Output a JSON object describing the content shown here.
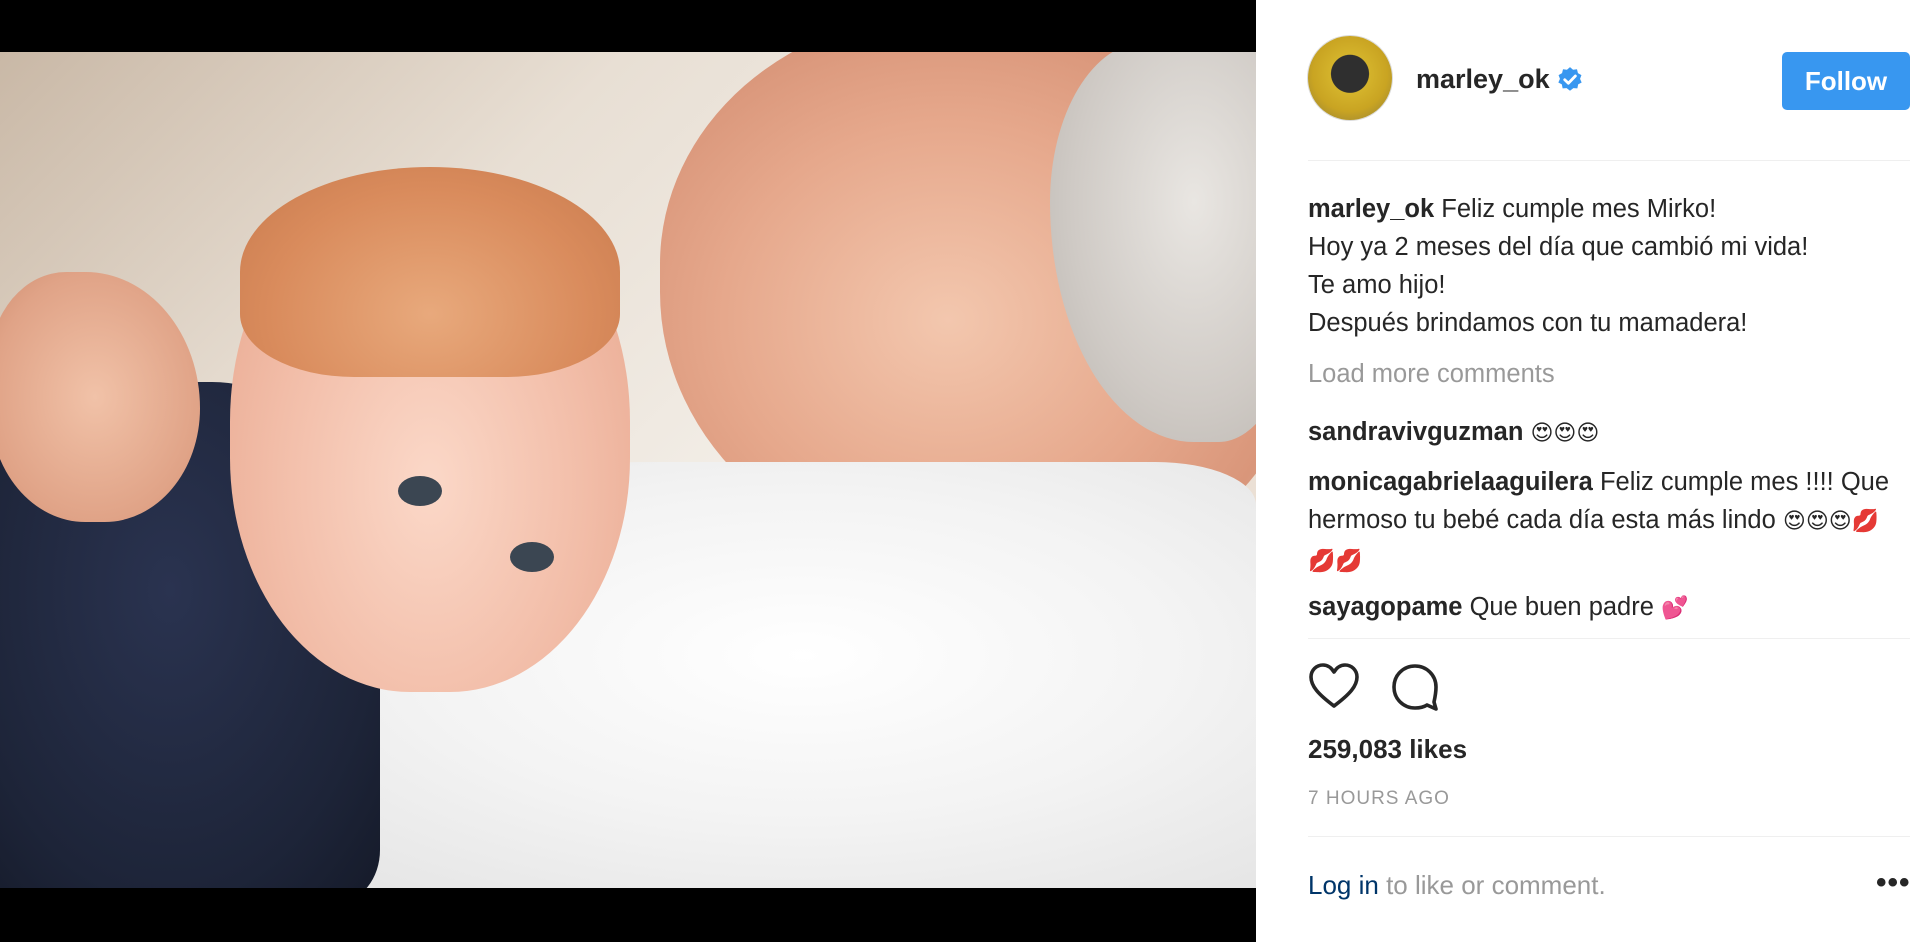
{
  "post": {
    "username": "marley_ok",
    "follow_label": "Follow",
    "caption": {
      "username": "marley_ok",
      "line1": "Feliz cumple mes Mirko!",
      "line2": "Hoy ya 2 meses del día que cambió mi vida!",
      "line3": "Te amo hijo!",
      "line4": "Después brindamos con tu mamadera!"
    },
    "load_more": "Load more comments",
    "comments": [
      {
        "username": "sandravivguzman",
        "text": "",
        "emoji": "😍😍😍"
      },
      {
        "username": "monicagabrielaaguilera",
        "text": "Feliz cumple mes !!!! Que hermoso tu bebé cada día esta más lindo",
        "emoji": "😍😍😍💋💋💋"
      },
      {
        "username": "sayagopame",
        "text": "Que buen padre",
        "emoji": "💕"
      }
    ],
    "likes": "259,083 likes",
    "time": "7 HOURS AGO",
    "login_link": "Log in",
    "login_rest": "to like or comment.",
    "more": "•••"
  },
  "icons": {
    "verified": "verified-badge-icon",
    "like": "heart-icon",
    "comment": "comment-bubble-icon",
    "more": "more-options-icon"
  },
  "colors": {
    "follow_button": "#3897f0",
    "verified": "#3897f0",
    "link": "#003569",
    "muted": "#999999"
  }
}
